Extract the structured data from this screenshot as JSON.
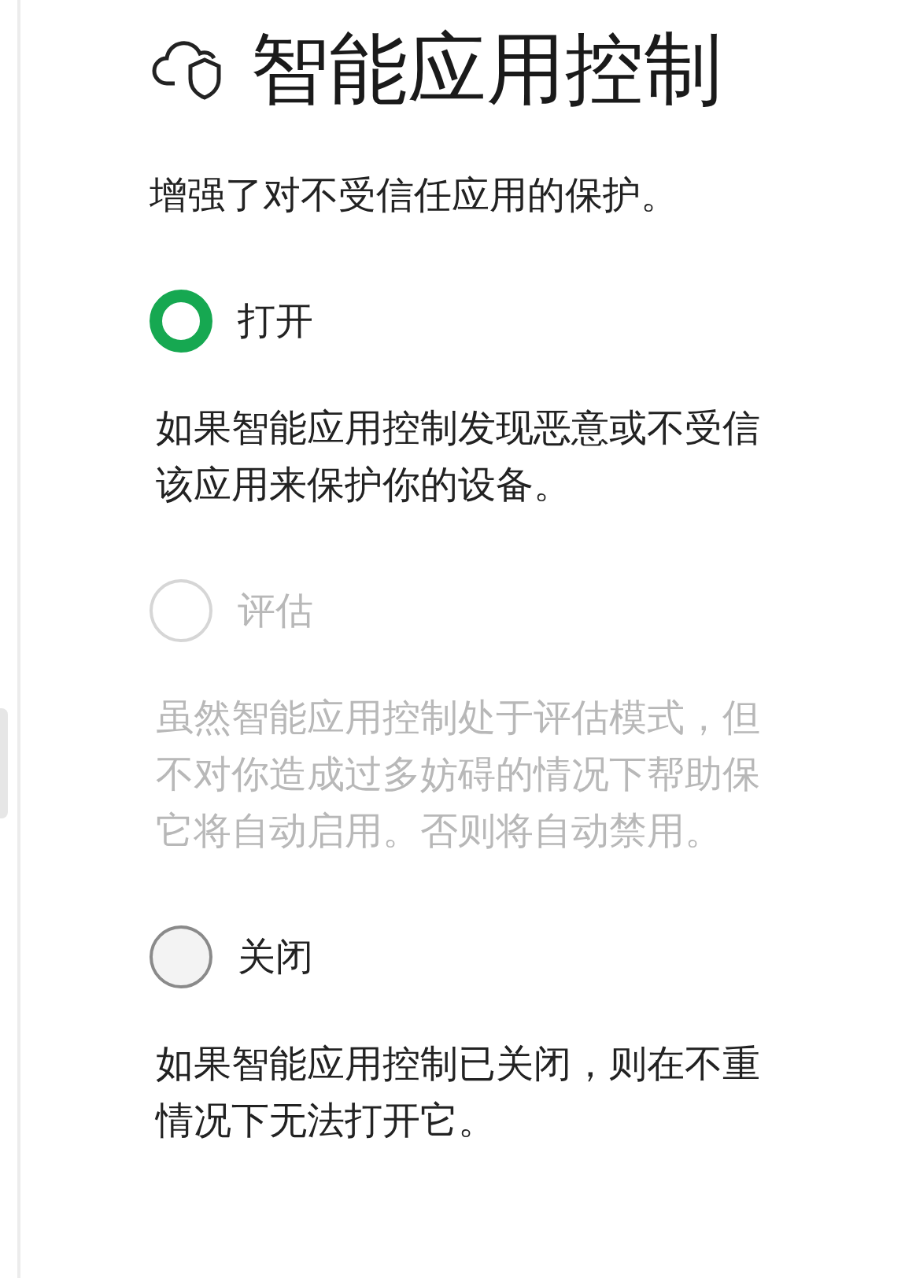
{
  "title": "智能应用控制",
  "subtitle": "增强了对不受信任应用的保护。",
  "options": [
    {
      "label": "打开",
      "selected": true,
      "disabled": false,
      "description": [
        "如果智能应用控制发现恶意或不受信",
        "该应用来保护你的设备。"
      ]
    },
    {
      "label": "评估",
      "selected": false,
      "disabled": true,
      "description": [
        "虽然智能应用控制处于评估模式，但",
        "不对你造成过多妨碍的情况下帮助保",
        "它将自动启用。否则将自动禁用。"
      ]
    },
    {
      "label": "关闭",
      "selected": false,
      "disabled": false,
      "description": [
        "如果智能应用控制已关闭，则在不重",
        "情况下无法打开它。"
      ]
    }
  ]
}
